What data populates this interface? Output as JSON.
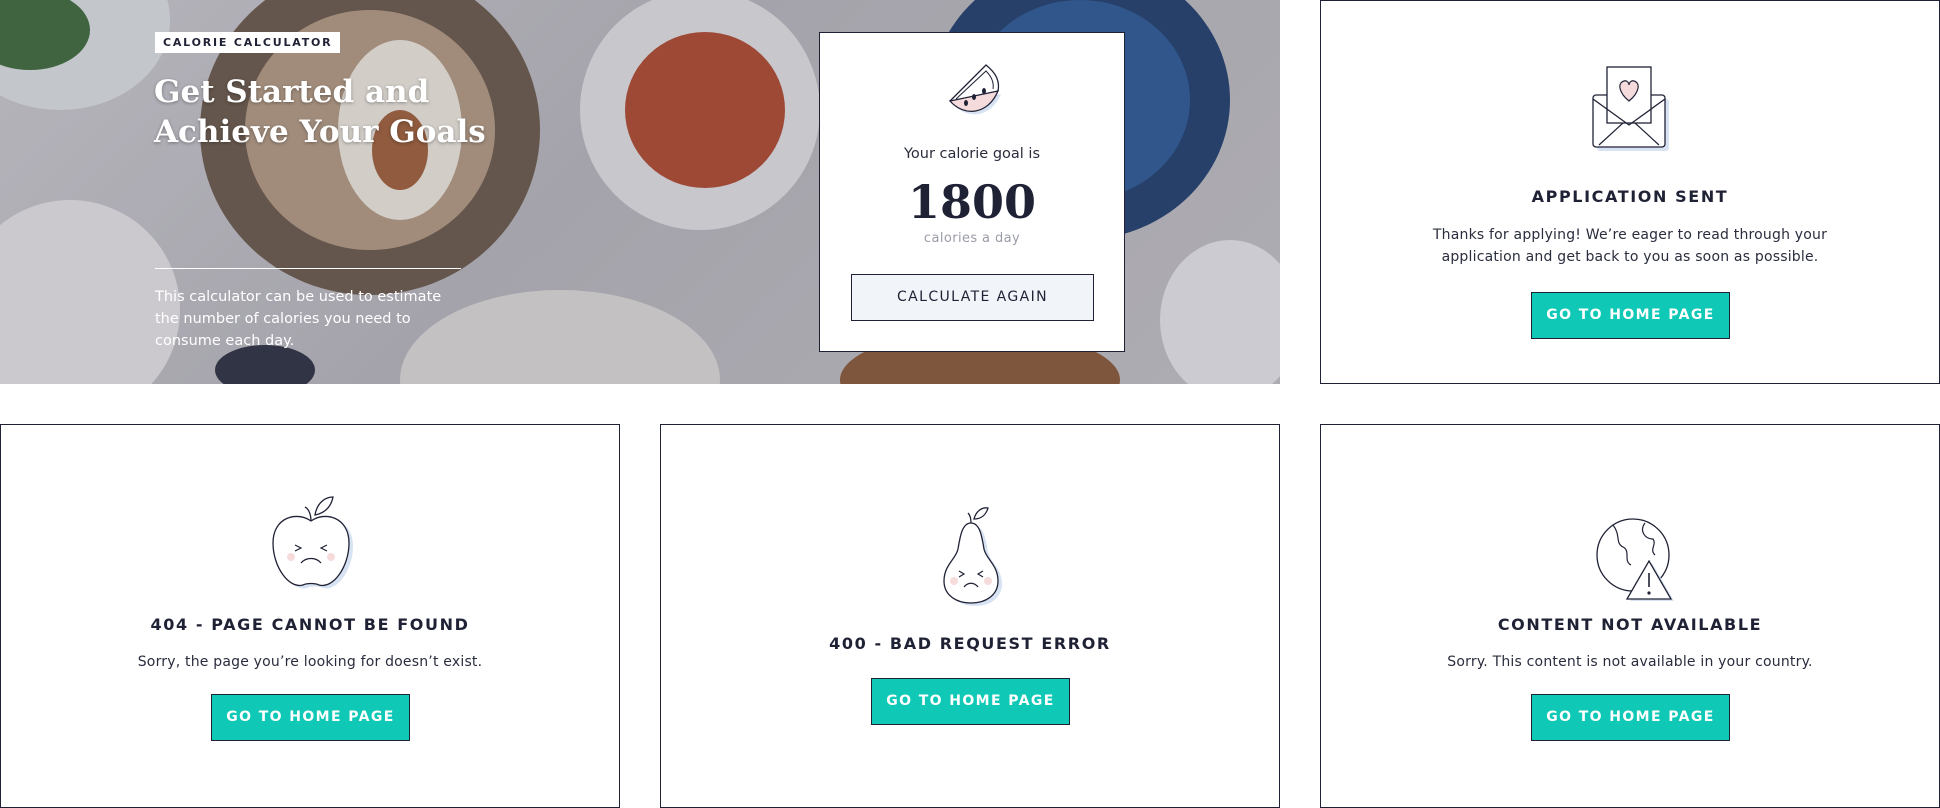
{
  "hero": {
    "badge": "CALORIE CALCULATOR",
    "title": "Get Started and Achieve Your Goals",
    "description": "This calculator can be used to estimate the number of calories you need to consume each day."
  },
  "calculator": {
    "caption": "Your calorie goal is",
    "value": "1800",
    "unit": "calories a day",
    "button": "CALCULATE AGAIN"
  },
  "application_sent": {
    "title": "APPLICATION SENT",
    "message": "Thanks for applying! We’re eager to read through your application and get back to you as soon as possible.",
    "button": "GO TO HOME PAGE"
  },
  "not_found": {
    "title": "404 - PAGE CANNOT BE FOUND",
    "message": "Sorry, the page you’re looking for doesn’t exist.",
    "button": "GO TO HOME PAGE"
  },
  "bad_request": {
    "title": "400 - BAD REQUEST ERROR",
    "button": "GO TO HOME PAGE"
  },
  "not_available": {
    "title": "CONTENT NOT AVAILABLE",
    "message": "Sorry. This content is not available in your country.",
    "button": "GO TO HOME PAGE"
  },
  "colors": {
    "accent": "#0fc8b5",
    "ink": "#1f2235",
    "pink": "#f6dbdc",
    "shadow": "#d7e2f3"
  },
  "icons": [
    "watermelon-icon",
    "envelope-heart-icon",
    "sad-apple-icon",
    "sad-pear-icon",
    "broken-globe-warning-icon"
  ]
}
